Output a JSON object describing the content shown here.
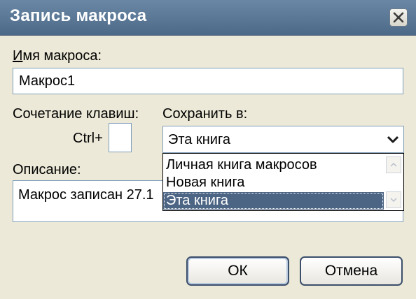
{
  "window": {
    "title": "Запись макроса"
  },
  "macro_name": {
    "label": "Имя макроса:",
    "value": "Макрос1"
  },
  "shortcut": {
    "label": "Сочетание клавиш:",
    "prefix": "Ctrl+",
    "value": ""
  },
  "store_in": {
    "label": "Сохранить в:",
    "selected": "Эта книга",
    "options": [
      "Личная книга макросов",
      "Новая книга",
      "Эта книга"
    ],
    "highlighted_option": "Эта книга"
  },
  "description": {
    "label": "Описание:",
    "value": "Макрос записан 27.1"
  },
  "buttons": {
    "ok": "ОК",
    "cancel": "Отмена"
  },
  "icons": {
    "close": "close-icon",
    "dropdown": "chevron-down-icon",
    "scroll_up": "scroll-up-icon",
    "scroll_down": "scroll-down-icon"
  },
  "colors": {
    "titlebar": "#5a7896",
    "dialog_bg": "#ece9d8",
    "selection": "#4d6585"
  }
}
